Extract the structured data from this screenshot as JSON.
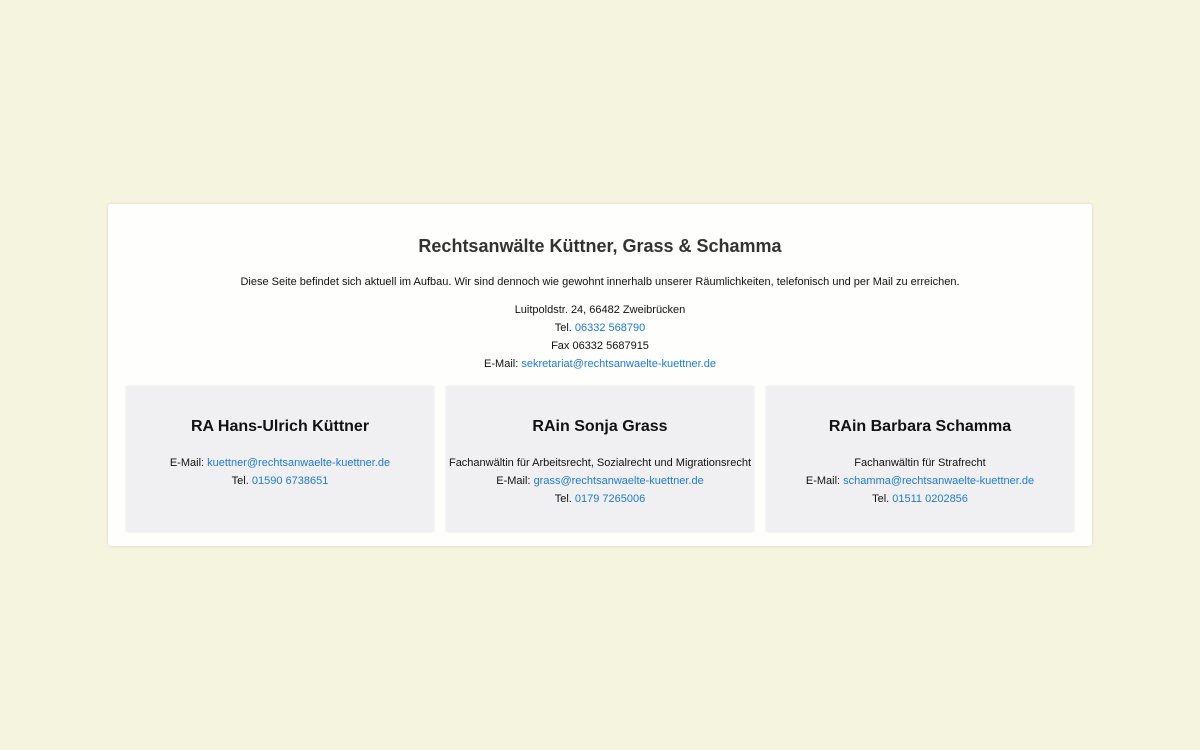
{
  "firm": {
    "title": "Rechtsanwälte Küttner, Grass & Schamma",
    "notice": "Diese Seite befindet sich aktuell im Aufbau. Wir sind dennoch wie gewohnt innerhalb unserer Räumlichkeiten, telefonisch und per Mail zu erreichen.",
    "address": "Luitpoldstr. 24, 66482 Zweibrücken",
    "tel_label": "Tel.",
    "tel": "06332 568790",
    "fax": "Fax 06332 5687915",
    "email_label": "E-Mail:",
    "email": "sekretariat@rechtsanwaelte-kuettner.de"
  },
  "lawyers": [
    {
      "name": "RA Hans-Ulrich Küttner",
      "email_label": "E-Mail:",
      "email": "kuettner@rechtsanwaelte-kuettner.de",
      "tel_label": "Tel.",
      "tel": "01590 6738651"
    },
    {
      "name": "RAin Sonja Grass",
      "specialty": "Fachanwältin für Arbeitsrecht, Sozialrecht und Migrationsrecht",
      "email_label": "E-Mail:",
      "email": "grass@rechtsanwaelte-kuettner.de",
      "tel_label": "Tel.",
      "tel": "0179 7265006"
    },
    {
      "name": "RAin Barbara Schamma",
      "specialty": "Fachanwältin für Strafrecht",
      "email_label": "E-Mail:",
      "email": "schamma@rechtsanwaelte-kuettner.de",
      "tel_label": "Tel.",
      "tel": "01511 0202856"
    }
  ],
  "colors": {
    "background": "#f5f4df",
    "panel": "#fefefc",
    "card": "#f0f0f2",
    "link": "#1e7ad8"
  }
}
